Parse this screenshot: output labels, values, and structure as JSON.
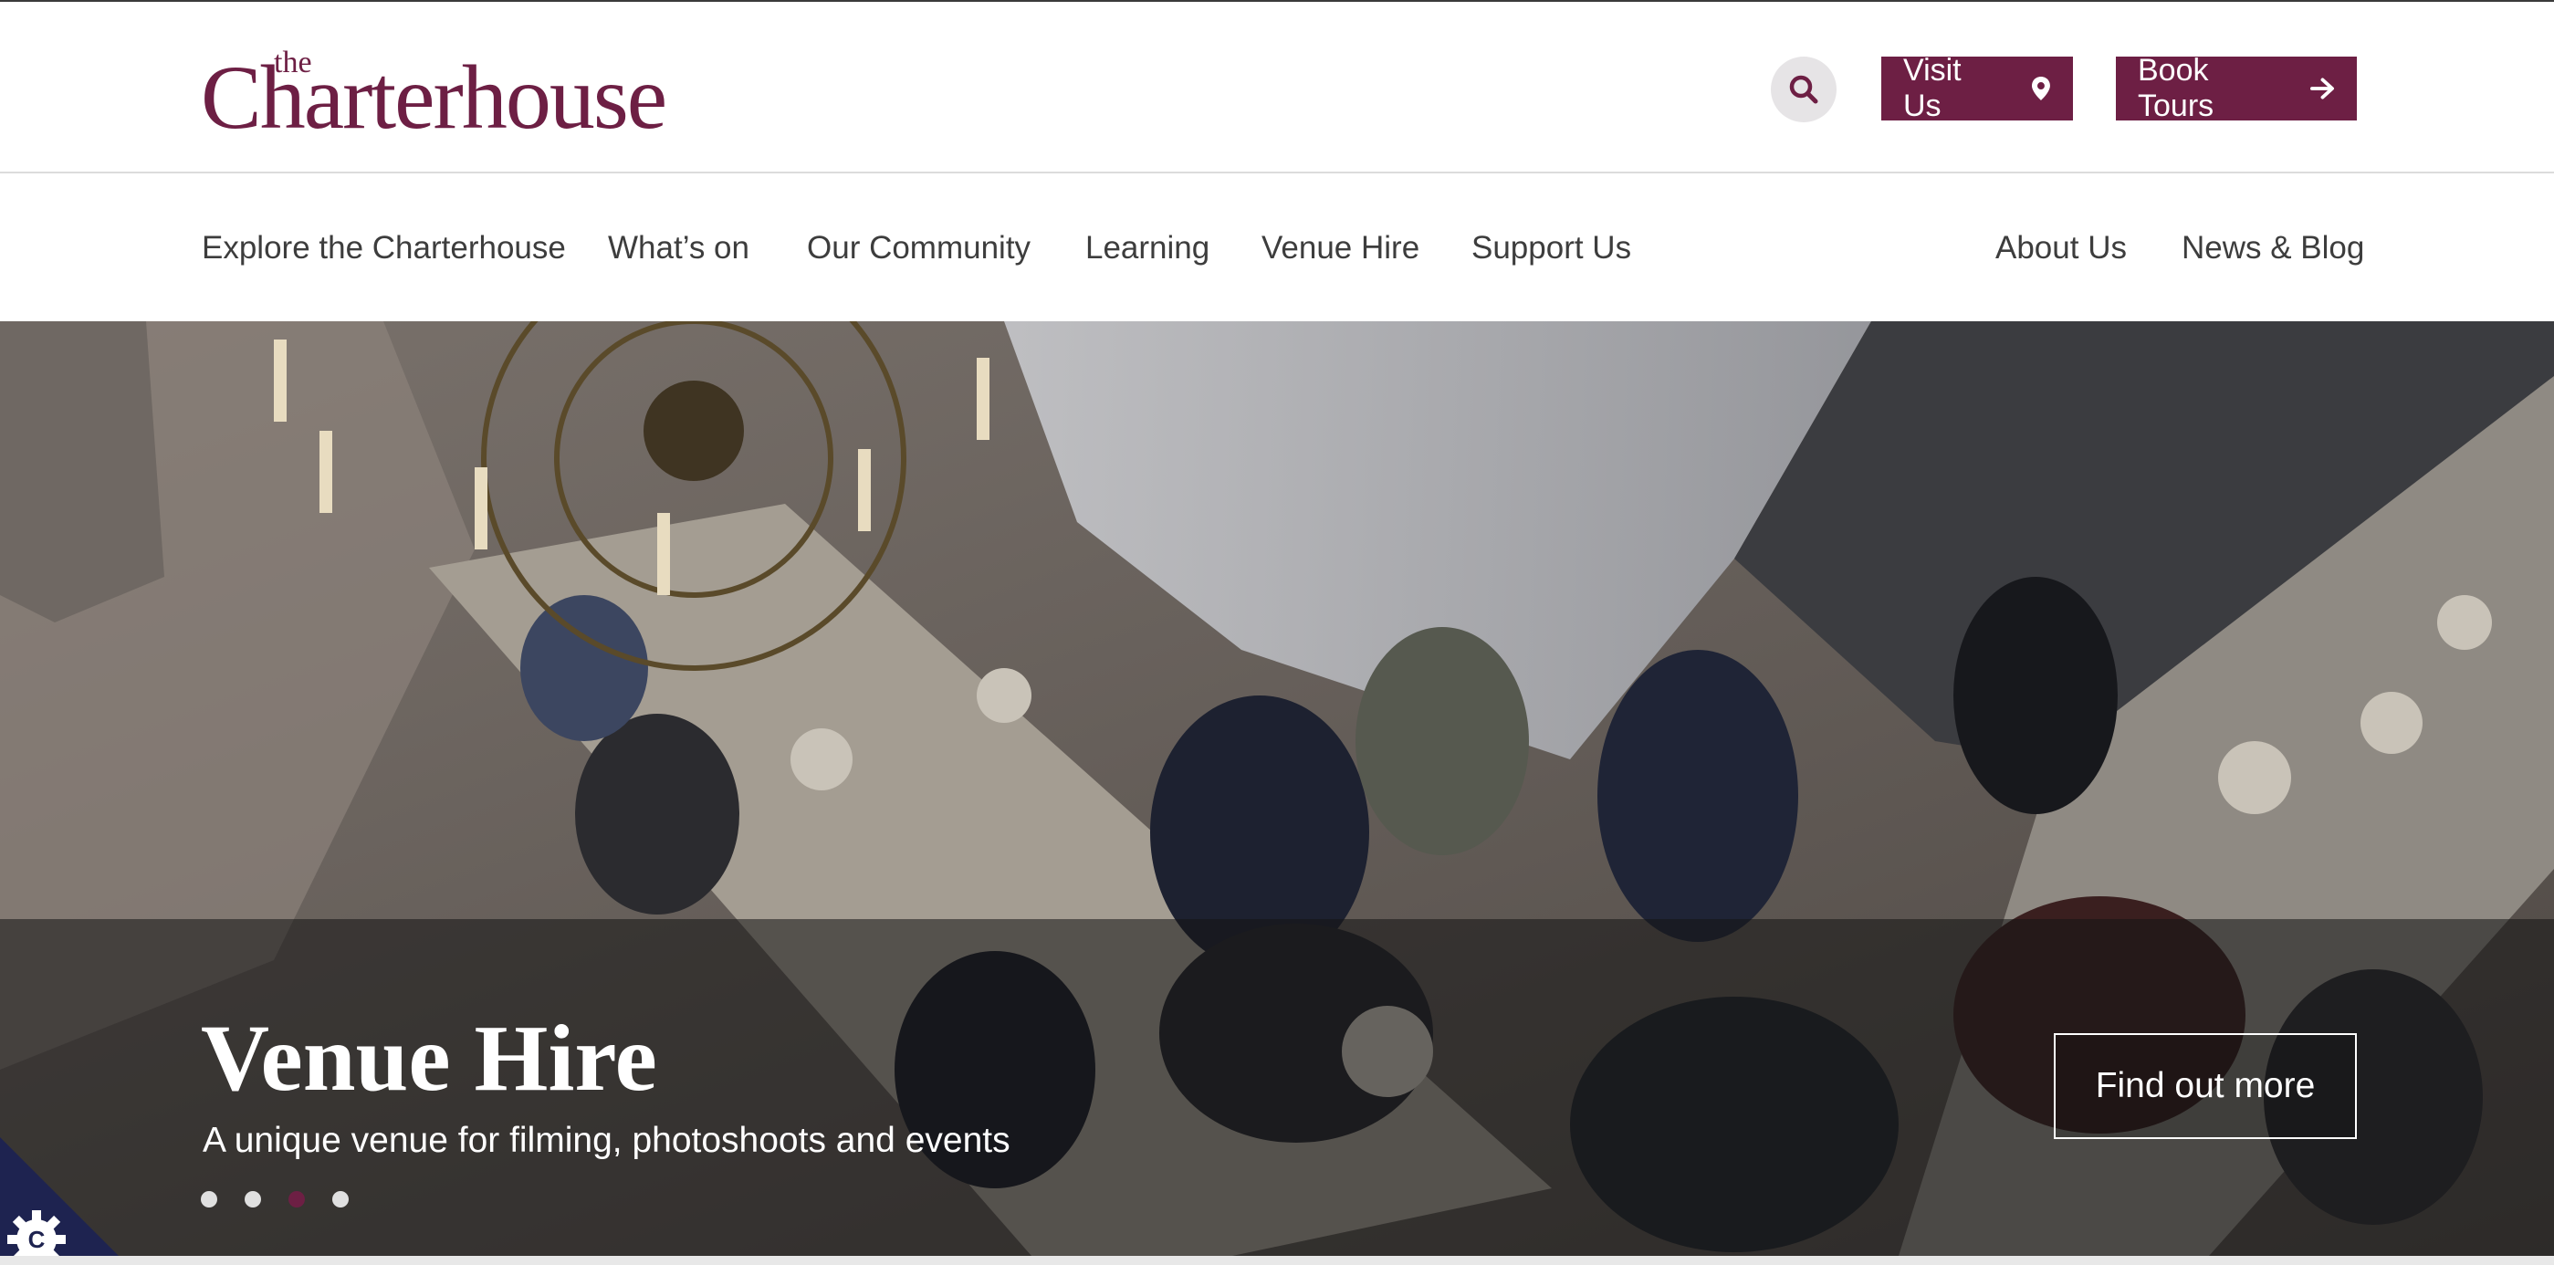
{
  "header": {
    "logo_small": "the",
    "logo_main": "Charterhouse",
    "visit_label": "Visit Us",
    "tours_label": "Book Tours"
  },
  "nav": {
    "left": [
      "Explore the Charterhouse",
      "What’s on",
      "Our Community",
      "Learning",
      "Venue Hire",
      "Support Us"
    ],
    "right": [
      "About Us",
      "News & Blog"
    ]
  },
  "hero": {
    "title": "Venue Hire",
    "subtitle": "A unique venue for filming, photoshoots and events",
    "cta": "Find out more",
    "slides": 4,
    "active_slide": 3
  },
  "colors": {
    "brand": "#6d1f44",
    "nav_text": "#3d3d3d",
    "search_bg": "#e6e4e6",
    "cookie_bg": "#1e2350"
  },
  "icons": [
    "search-icon",
    "location-pin-icon",
    "arrow-right-icon",
    "cookie-gear-icon"
  ]
}
